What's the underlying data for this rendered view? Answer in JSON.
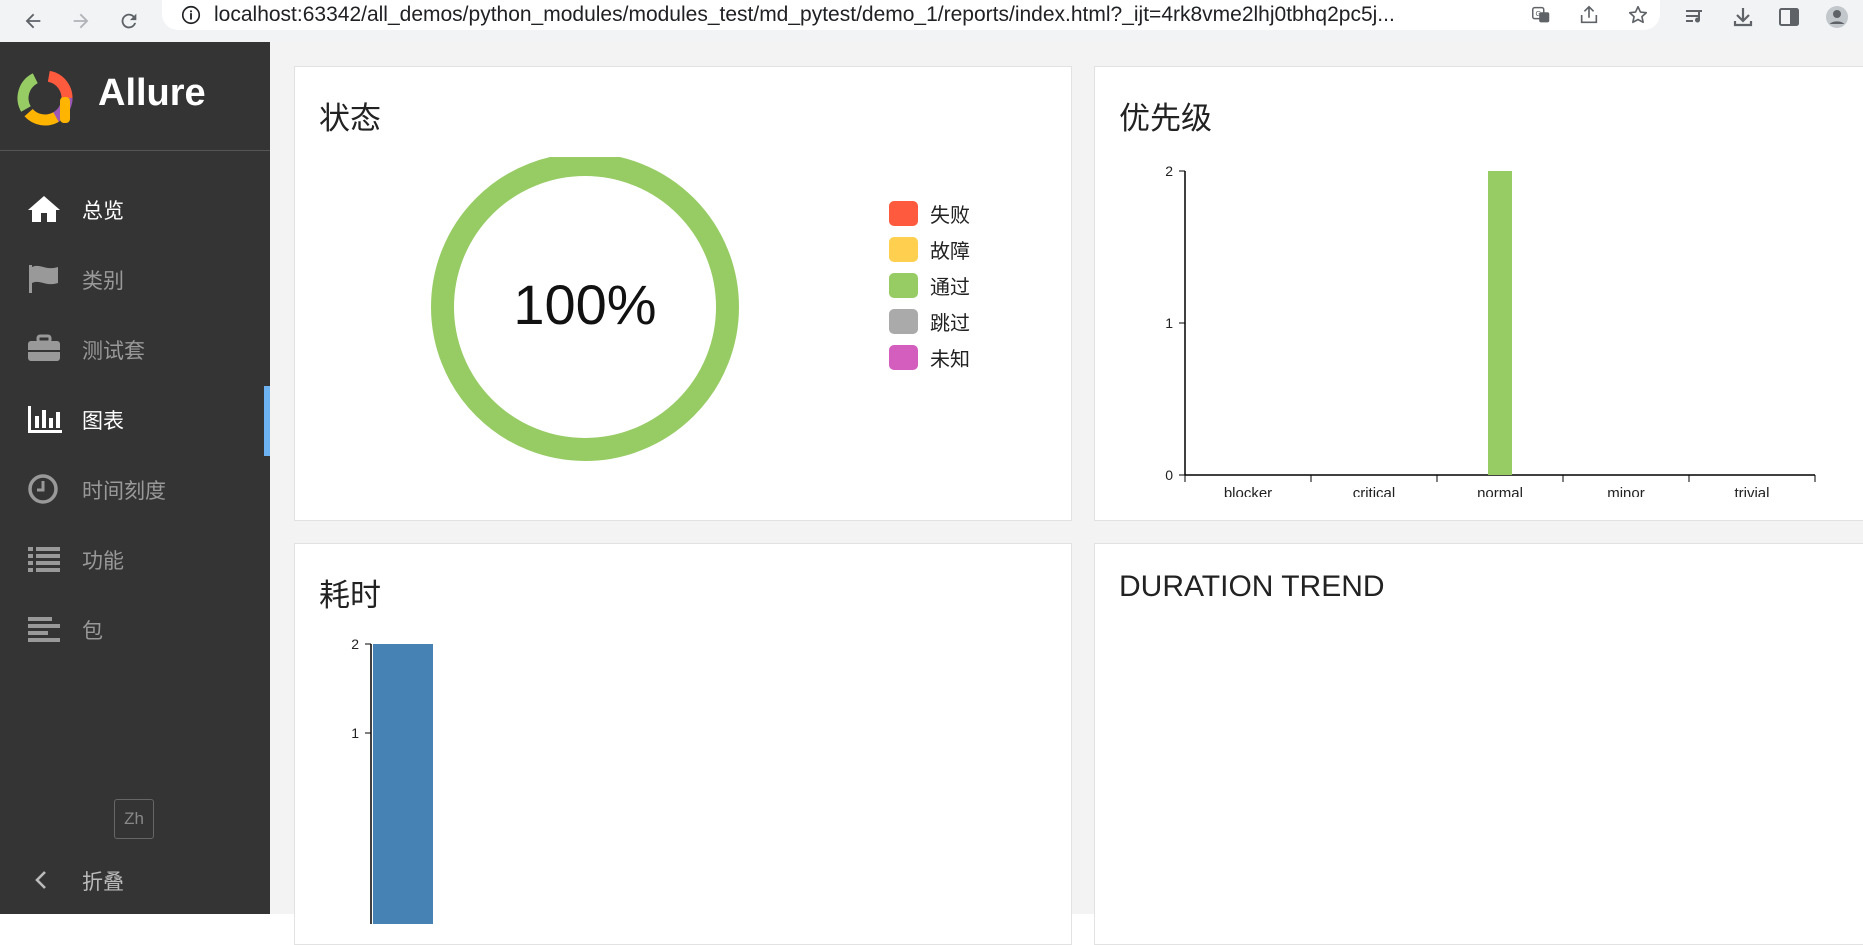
{
  "browser": {
    "url_host": "localhost",
    "url_rest": ":63342/all_demos/python_modules/modules_test/md_pytest/demo_1/reports/index.html?_ijt=4rk8vme2lhj0tbhq2pc5j..."
  },
  "sidebar": {
    "app_name": "Allure",
    "items": [
      {
        "label": "总览",
        "icon": "home-icon",
        "active": true
      },
      {
        "label": "类别",
        "icon": "flag-icon",
        "active": false
      },
      {
        "label": "测试套",
        "icon": "briefcase-icon",
        "active": false
      },
      {
        "label": "图表",
        "icon": "bar-chart-icon",
        "active": true,
        "selected": true
      },
      {
        "label": "时间刻度",
        "icon": "clock-icon",
        "active": false
      },
      {
        "label": "功能",
        "icon": "list-icon",
        "active": false
      },
      {
        "label": "包",
        "icon": "align-left-icon",
        "active": false
      }
    ],
    "language": "Zh",
    "collapse_label": "折叠"
  },
  "widgets": {
    "status": {
      "title": "状态",
      "percent_label": "100%",
      "legend": [
        {
          "label": "失败",
          "color": "#fd5a3e"
        },
        {
          "label": "故障",
          "color": "#ffd050"
        },
        {
          "label": "通过",
          "color": "#97cc64"
        },
        {
          "label": "跳过",
          "color": "#aaaaaa"
        },
        {
          "label": "未知",
          "color": "#d35ebe"
        }
      ]
    },
    "severity": {
      "title": "优先级"
    },
    "duration": {
      "title": "耗时"
    },
    "duration_trend": {
      "title": "DURATION TREND"
    }
  },
  "chart_data": [
    {
      "type": "pie",
      "title": "状态",
      "categories": [
        "失败",
        "故障",
        "通过",
        "跳过",
        "未知"
      ],
      "values": [
        0,
        0,
        2,
        0,
        0
      ],
      "center_label": "100%",
      "colors": [
        "#fd5a3e",
        "#ffd050",
        "#97cc64",
        "#aaaaaa",
        "#d35ebe"
      ]
    },
    {
      "type": "bar",
      "title": "优先级",
      "categories": [
        "blocker",
        "critical",
        "normal",
        "minor",
        "trivial"
      ],
      "values": [
        0,
        0,
        2,
        0,
        0
      ],
      "yticks": [
        0,
        1,
        2
      ],
      "ylim": [
        0,
        2
      ],
      "color": "#97cc64"
    },
    {
      "type": "bar",
      "title": "耗时",
      "values": [
        2
      ],
      "yticks": [
        1,
        2
      ],
      "color": "#4682b4"
    }
  ]
}
